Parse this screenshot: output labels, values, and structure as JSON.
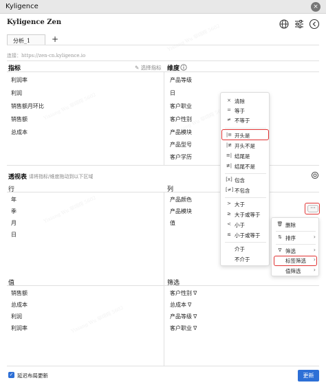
{
  "window": {
    "title": "Kyligence",
    "close": "×"
  },
  "header": {
    "brand": "Kyligence Zen",
    "icons": [
      "globe-icon",
      "sliders-icon",
      "collapse-icon"
    ]
  },
  "tabs": [
    {
      "label": "分析_1"
    }
  ],
  "tab_add": "+",
  "connection": "连接：https://zen-cn.kyligence.io",
  "metrics": {
    "title": "指标",
    "select_label": "选择指标",
    "items": [
      "利润率",
      "利润",
      "销售额月环比",
      "销售额",
      "总成本"
    ]
  },
  "dimensions": {
    "title": "维度",
    "items": [
      "产品等级",
      "日",
      "客户职业",
      "客户性别",
      "产品模块",
      "产品型号",
      "客户学历"
    ]
  },
  "pivot": {
    "title": "透视表",
    "hint": "请将指标/维度拖动到以下区域",
    "rows_label": "行",
    "rows": [
      "年",
      "季",
      "月",
      "日"
    ],
    "cols_label": "列",
    "cols": [
      "产品颜色",
      "产品模块",
      "值"
    ],
    "values_label": "值",
    "values": [
      "销售额",
      "总成本",
      "利润",
      "利润率"
    ],
    "filters_label": "筛选",
    "filters": [
      "客户性别",
      "总成本",
      "产品等级",
      "客户职业"
    ],
    "filter_icon": "∇",
    "more": "···"
  },
  "label_filter_menu": {
    "items": [
      {
        "icon": "×",
        "label": "清除"
      },
      {
        "icon": "=",
        "label": "等于"
      },
      {
        "icon": "≠",
        "label": "不等于"
      },
      {
        "icon": "|≡",
        "label": "开头是"
      },
      {
        "icon": "|≢",
        "label": "开头不是"
      },
      {
        "icon": "≡|",
        "label": "结尾是"
      },
      {
        "icon": "≢|",
        "label": "结尾不是"
      },
      {
        "icon": "[x]",
        "label": "包含"
      },
      {
        "icon": "[≠]",
        "label": "不包含"
      },
      {
        "icon": ">",
        "label": "大于"
      },
      {
        "icon": "≥",
        "label": "大于或等于"
      },
      {
        "icon": "<",
        "label": "小于"
      },
      {
        "icon": "≤",
        "label": "小于或等于"
      },
      {
        "icon": "",
        "label": "介于"
      },
      {
        "icon": "",
        "label": "不介于"
      }
    ]
  },
  "field_menu": {
    "items": [
      {
        "icon": "🗑",
        "label": "删除",
        "chevron": ""
      },
      {
        "icon": "⇅",
        "label": "排序",
        "chevron": "›"
      },
      {
        "icon": "∇",
        "label": "筛选",
        "chevron": "›"
      },
      {
        "icon": "",
        "label": "标签筛选",
        "chevron": "›"
      },
      {
        "icon": "",
        "label": "值筛选",
        "chevron": "›"
      }
    ]
  },
  "footer": {
    "defer_label": "延迟布局更新",
    "update_button": "更新"
  },
  "watermark": "Yixiang Wu 邬翊翔 5602",
  "colors": {
    "accent": "#2d6fd6",
    "highlight": "#e03030"
  }
}
